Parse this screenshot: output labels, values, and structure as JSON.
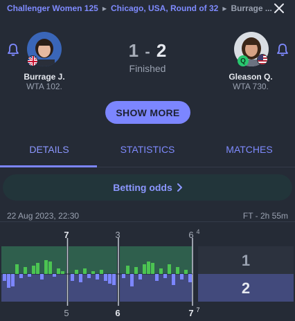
{
  "breadcrumb": [
    "Challenger Women 125",
    "Chicago, USA, Round of 32",
    "Burrage ..."
  ],
  "players": {
    "home": {
      "name": "Burrage J.",
      "rank": "WTA 102."
    },
    "away": {
      "name": "Gleason Q.",
      "rank": "WTA 730.",
      "badge": "Q"
    }
  },
  "score": {
    "home": "1",
    "separator": "-",
    "away": "2",
    "status": "Finished"
  },
  "show_more_label": "SHOW MORE",
  "tabs": [
    "DETAILS",
    "STATISTICS",
    "MATCHES"
  ],
  "betting_odds_label": "Betting odds",
  "match_date": "22 Aug 2023, 22:30",
  "match_result": "FT - 2h 55m",
  "sets": [
    {
      "home": "7",
      "away": "5"
    },
    {
      "home": "3",
      "away": "6"
    },
    {
      "home": "6",
      "home_tiebreak": "4",
      "away": "7",
      "away_tiebreak": "7"
    }
  ],
  "set_summary": {
    "home": "1",
    "away": "2"
  },
  "colors": {
    "accent": "#7c86ff",
    "home_bar": "#4cc452",
    "away_bar": "#7c86ff",
    "page_bg": "#252b36"
  },
  "icons": [
    "close-icon",
    "bell-icon",
    "chevron-right-icon",
    "flag-gb-icon",
    "flag-us-icon"
  ]
}
